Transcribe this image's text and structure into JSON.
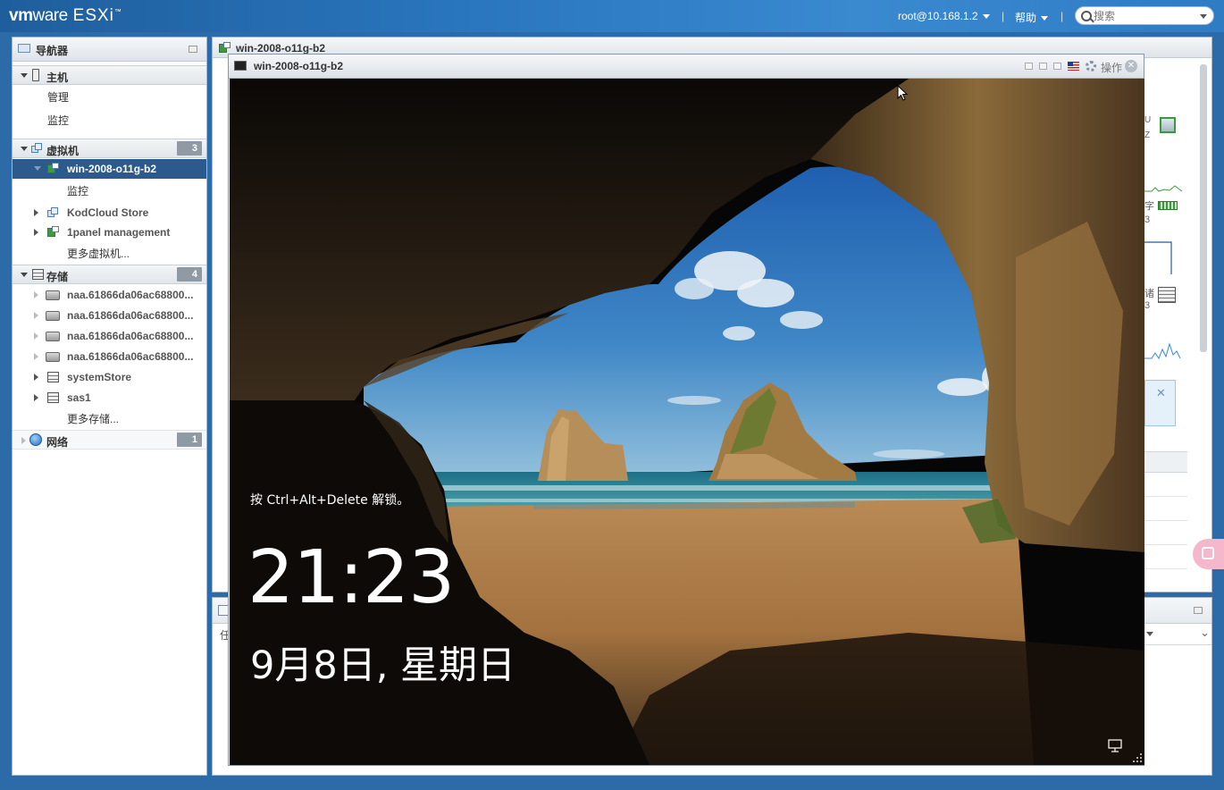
{
  "topbar": {
    "brand_vm": "vm",
    "brand_ware": "ware",
    "brand_product": "ESXi",
    "brand_tm": "™",
    "user": "root@10.168.1.2",
    "help": "帮助",
    "separator": "|",
    "search_placeholder": "搜索"
  },
  "navigator": {
    "title": "导航器",
    "host": {
      "label": "主机",
      "items": [
        "管理",
        "监控"
      ]
    },
    "vms": {
      "label": "虚拟机",
      "count": "3",
      "selected": "win-2008-o11g-b2",
      "selected_child": "监控",
      "others": [
        "KodCloud Store",
        "1panel management"
      ],
      "more": "更多虚拟机..."
    },
    "storage": {
      "label": "存储",
      "count": "4",
      "disks": [
        "naa.61866da06ac68800...",
        "naa.61866da06ac68800...",
        "naa.61866da06ac68800...",
        "naa.61866da06ac68800..."
      ],
      "stores": [
        "systemStore",
        "sas1"
      ],
      "more": "更多存储..."
    },
    "network": {
      "label": "网络",
      "count": "1"
    }
  },
  "main": {
    "title": "win-2008-o11g-b2",
    "right_fragments": [
      "U",
      "Z",
      "字",
      "3",
      "诸",
      "3"
    ],
    "bottom_fragment": "任"
  },
  "console": {
    "title": "win-2008-o11g-b2",
    "actions_label": "操作",
    "lock_hint": "按 Ctrl+Alt+Delete 解锁。",
    "time": "21:23",
    "date": "9月8日, 星期日"
  },
  "colors": {
    "topbar": "#2a77c0",
    "nav_selected": "#2c5a8c",
    "badge": "#8f9aa5"
  }
}
